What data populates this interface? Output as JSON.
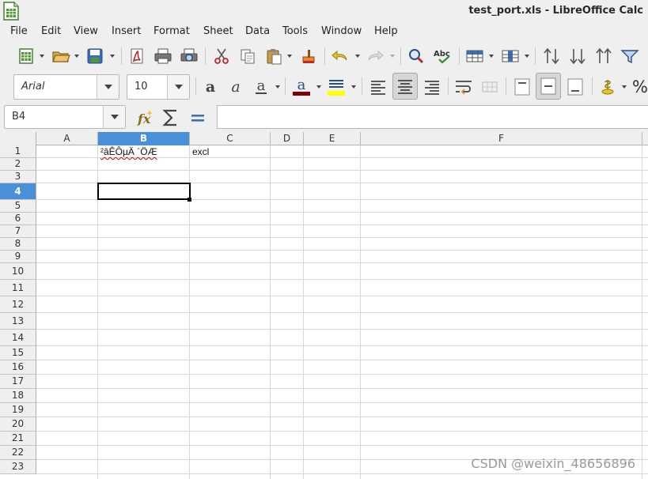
{
  "window": {
    "title": "test_port.xls - LibreOffice Calc"
  },
  "menubar": {
    "items": [
      "File",
      "Edit",
      "View",
      "Insert",
      "Format",
      "Sheet",
      "Data",
      "Tools",
      "Window",
      "Help"
    ]
  },
  "toolbar": {
    "standard": [
      "new-spreadsheet",
      "open",
      "save",
      "export-pdf",
      "print",
      "print-preview",
      "cut",
      "copy",
      "paste",
      "clone-formatting",
      "undo",
      "redo",
      "find-replace",
      "spelling",
      "row",
      "column",
      "sort",
      "sort-ascending",
      "sort-descending",
      "autofilter"
    ],
    "font_name": "Arial",
    "font_size": "10",
    "percent_label": "%"
  },
  "formula_bar": {
    "name_box": "B4",
    "formula": ""
  },
  "sheet": {
    "columns": [
      "A",
      "B",
      "C",
      "D",
      "E",
      "F"
    ],
    "selected_column": "B",
    "rows": [
      "1",
      "2",
      "3",
      "4",
      "5",
      "6",
      "7",
      "8",
      "9",
      "10",
      "11",
      "12",
      "13",
      "14",
      "15",
      "16",
      "17",
      "18",
      "19",
      "20",
      "21",
      "22",
      "23"
    ],
    "selected_row": "4",
    "cells": {
      "B1": "²âÊÔµÄ ´ÖÆ",
      "C1": "excl"
    },
    "active_cell": "B4"
  },
  "watermark": "CSDN @weixin_48656896",
  "colors": {
    "accent": "#4a90d9",
    "font_color": "#c00000",
    "highlight_color": "#ffff00"
  }
}
